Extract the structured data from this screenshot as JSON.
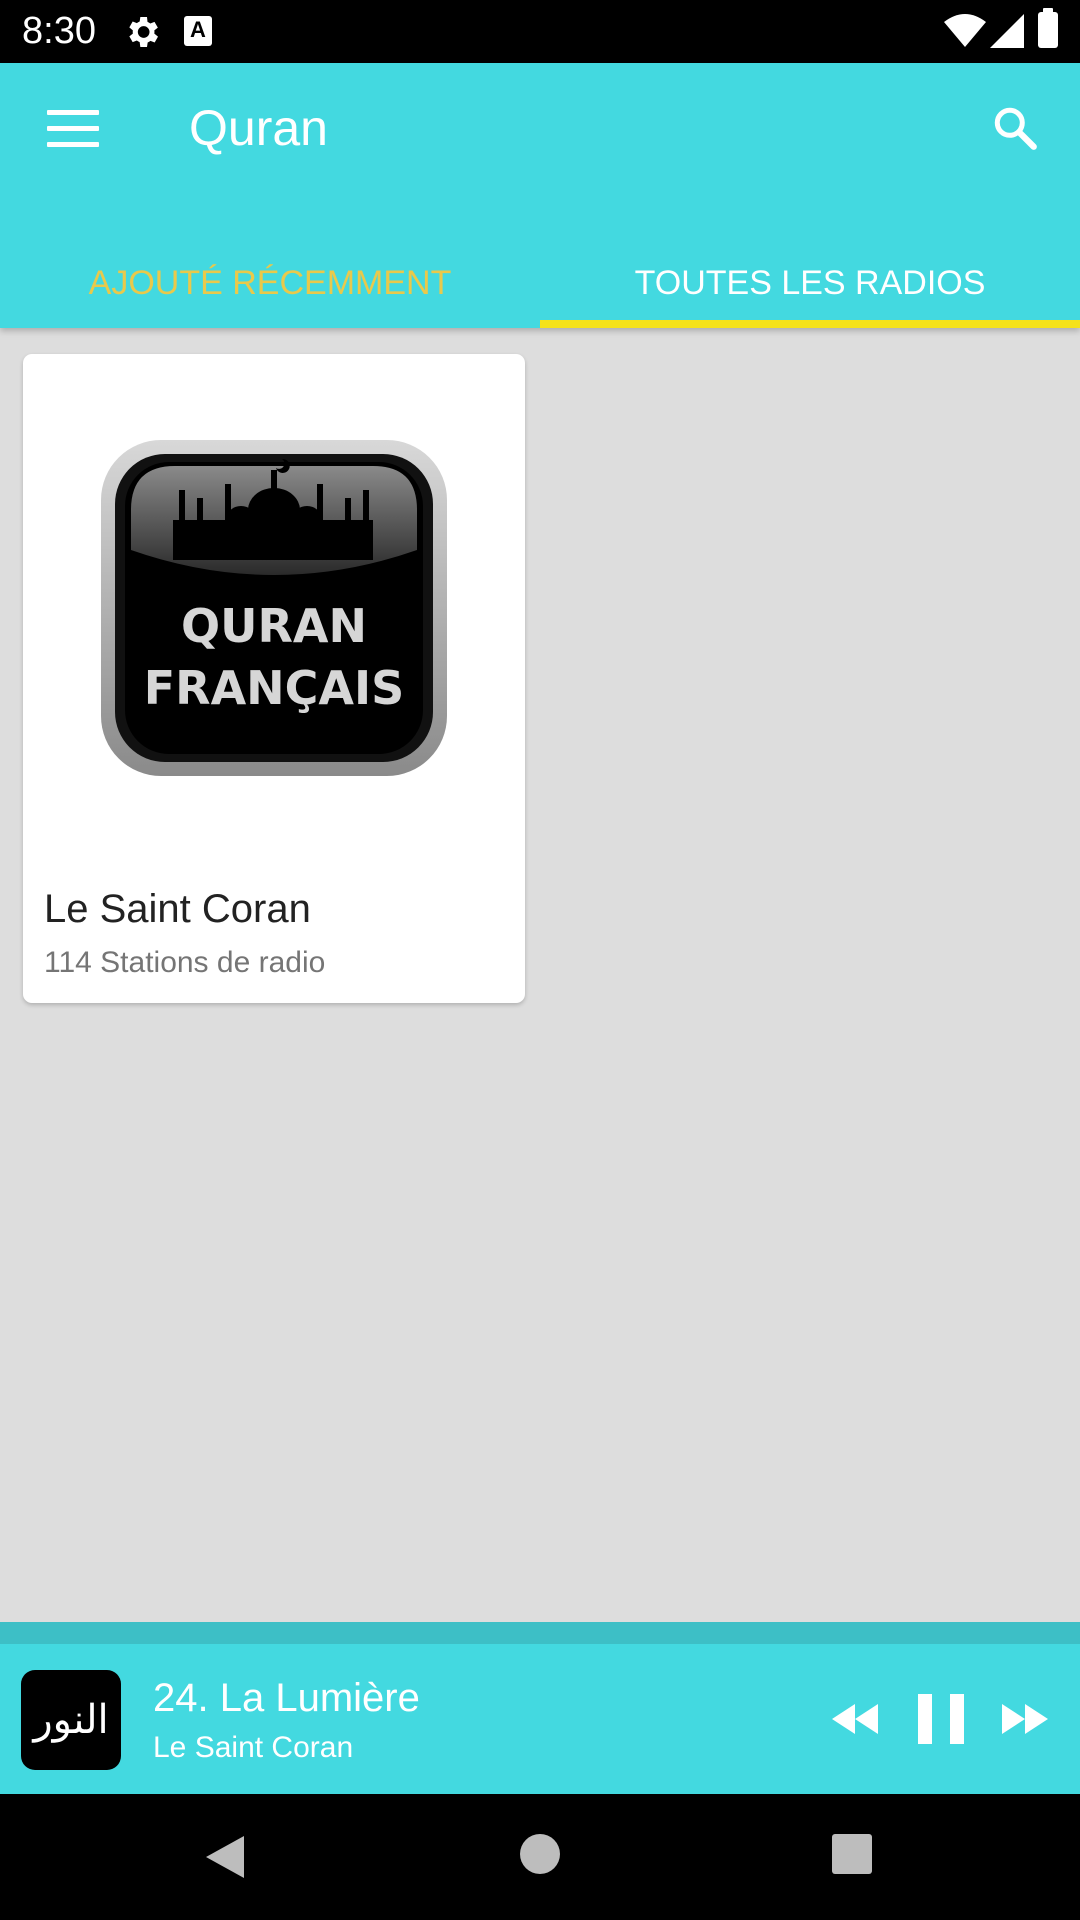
{
  "status_bar": {
    "time": "8:30",
    "icons": [
      "gear-icon",
      "a-badge-icon",
      "wifi-icon",
      "signal-icon",
      "battery-icon"
    ],
    "a_badge": "A"
  },
  "app_bar": {
    "title": "Quran",
    "background_color": "#43d9e0",
    "menu_icon": "menu-icon",
    "search_icon": "search-icon"
  },
  "tabs": [
    {
      "label": "AJOUTÉ RÉCEMMENT",
      "selected": false,
      "color": "#e9c94b"
    },
    {
      "label": "TOUTES LES RADIOS",
      "selected": true,
      "color": "#ffffff"
    }
  ],
  "tab_indicator_color": "#f5e21a",
  "cards": [
    {
      "image_text_line1": "QURAN",
      "image_text_line2": "FRANÇAIS",
      "title": "Le Saint Coran",
      "subtitle": "114 Stations de radio"
    }
  ],
  "player": {
    "art_text": "النور",
    "title": "24. La Lumière",
    "subtitle": "Le Saint Coran",
    "controls": [
      "rewind-icon",
      "pause-icon",
      "fast-forward-icon"
    ],
    "state": "playing"
  },
  "nav_bar": {
    "buttons": [
      "back",
      "home",
      "recents"
    ]
  }
}
